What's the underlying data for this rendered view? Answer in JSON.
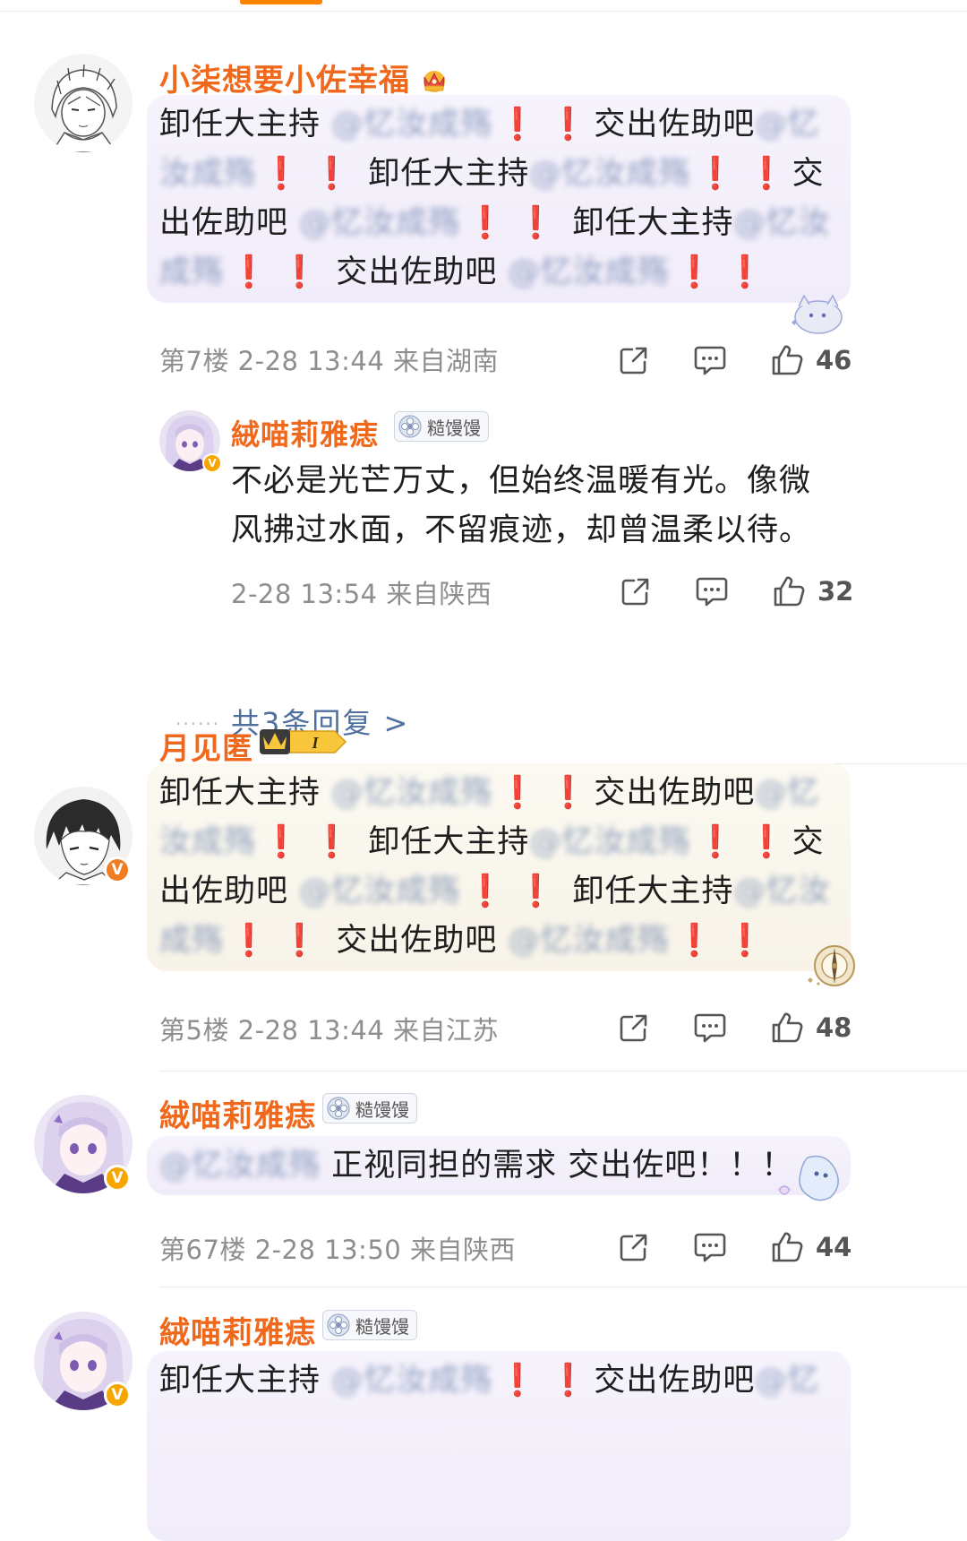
{
  "comments": [
    {
      "username": "小柒想要小佐幸福",
      "badge_icon": "crown-icon",
      "text_parts": [
        "卸任大主持",
        "@忆汝成殇",
        "交出佐助吧",
        "@忆汝成殇",
        "卸任大主持",
        "@忆汝成殇",
        "交出佐助吧",
        "@忆汝成殇",
        "卸任大主持",
        "@忆汝成殇",
        "交出佐助吧",
        "@忆汝成殇"
      ],
      "bang": "❗",
      "meta": "第7楼 2-28 13:44 来自湖南",
      "likes": "46",
      "reply": {
        "username": "絨喵莉雅痣",
        "fan_badge": "糙馒馒",
        "text_line1": "不必是光芒万丈，但始终温暖有光。像微",
        "text_line2": "风拂过水面，不留痕迹，却曾温柔以待。",
        "meta": "2-28 13:54 来自陕西",
        "likes": "32"
      },
      "more_dots": "......",
      "more_replies": "共3条回复 >"
    },
    {
      "username": "月见匿",
      "level_badge": "I",
      "verified": "V",
      "meta": "第5楼 2-28 13:44 来自江苏",
      "likes": "48"
    },
    {
      "username": "絨喵莉雅痣",
      "fan_badge": "糙馒馒",
      "verified": "V",
      "mention": "@忆汝成殇",
      "text": " 正视同担的需求 交出佐吧！！！",
      "meta": "第67楼 2-28 13:50 来自陕西",
      "likes": "44"
    },
    {
      "username": "絨喵莉雅痣",
      "fan_badge": "糙馒馒",
      "verified": "V",
      "text_start": "卸任大主持",
      "mention": "@忆汝成殇",
      "text_after": "交出佐助吧",
      "mention2": "@忆"
    }
  ],
  "colors": {
    "username": "#f0681c",
    "mention": "#4f6f9f",
    "bang": "#e0202a",
    "meta": "#8e8e8e",
    "brand": "#ff8200"
  }
}
